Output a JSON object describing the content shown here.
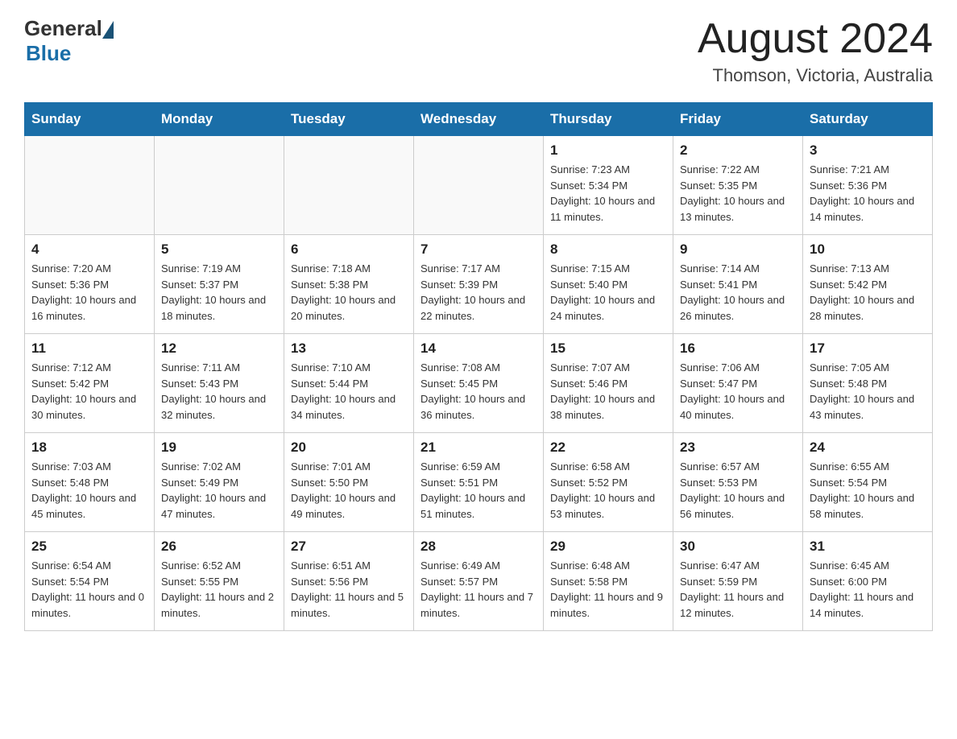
{
  "header": {
    "title": "August 2024",
    "location": "Thomson, Victoria, Australia",
    "logo_general": "General",
    "logo_blue": "Blue"
  },
  "calendar": {
    "days_of_week": [
      "Sunday",
      "Monday",
      "Tuesday",
      "Wednesday",
      "Thursday",
      "Friday",
      "Saturday"
    ],
    "weeks": [
      [
        {
          "day": "",
          "info": ""
        },
        {
          "day": "",
          "info": ""
        },
        {
          "day": "",
          "info": ""
        },
        {
          "day": "",
          "info": ""
        },
        {
          "day": "1",
          "info": "Sunrise: 7:23 AM\nSunset: 5:34 PM\nDaylight: 10 hours and 11 minutes."
        },
        {
          "day": "2",
          "info": "Sunrise: 7:22 AM\nSunset: 5:35 PM\nDaylight: 10 hours and 13 minutes."
        },
        {
          "day": "3",
          "info": "Sunrise: 7:21 AM\nSunset: 5:36 PM\nDaylight: 10 hours and 14 minutes."
        }
      ],
      [
        {
          "day": "4",
          "info": "Sunrise: 7:20 AM\nSunset: 5:36 PM\nDaylight: 10 hours and 16 minutes."
        },
        {
          "day": "5",
          "info": "Sunrise: 7:19 AM\nSunset: 5:37 PM\nDaylight: 10 hours and 18 minutes."
        },
        {
          "day": "6",
          "info": "Sunrise: 7:18 AM\nSunset: 5:38 PM\nDaylight: 10 hours and 20 minutes."
        },
        {
          "day": "7",
          "info": "Sunrise: 7:17 AM\nSunset: 5:39 PM\nDaylight: 10 hours and 22 minutes."
        },
        {
          "day": "8",
          "info": "Sunrise: 7:15 AM\nSunset: 5:40 PM\nDaylight: 10 hours and 24 minutes."
        },
        {
          "day": "9",
          "info": "Sunrise: 7:14 AM\nSunset: 5:41 PM\nDaylight: 10 hours and 26 minutes."
        },
        {
          "day": "10",
          "info": "Sunrise: 7:13 AM\nSunset: 5:42 PM\nDaylight: 10 hours and 28 minutes."
        }
      ],
      [
        {
          "day": "11",
          "info": "Sunrise: 7:12 AM\nSunset: 5:42 PM\nDaylight: 10 hours and 30 minutes."
        },
        {
          "day": "12",
          "info": "Sunrise: 7:11 AM\nSunset: 5:43 PM\nDaylight: 10 hours and 32 minutes."
        },
        {
          "day": "13",
          "info": "Sunrise: 7:10 AM\nSunset: 5:44 PM\nDaylight: 10 hours and 34 minutes."
        },
        {
          "day": "14",
          "info": "Sunrise: 7:08 AM\nSunset: 5:45 PM\nDaylight: 10 hours and 36 minutes."
        },
        {
          "day": "15",
          "info": "Sunrise: 7:07 AM\nSunset: 5:46 PM\nDaylight: 10 hours and 38 minutes."
        },
        {
          "day": "16",
          "info": "Sunrise: 7:06 AM\nSunset: 5:47 PM\nDaylight: 10 hours and 40 minutes."
        },
        {
          "day": "17",
          "info": "Sunrise: 7:05 AM\nSunset: 5:48 PM\nDaylight: 10 hours and 43 minutes."
        }
      ],
      [
        {
          "day": "18",
          "info": "Sunrise: 7:03 AM\nSunset: 5:48 PM\nDaylight: 10 hours and 45 minutes."
        },
        {
          "day": "19",
          "info": "Sunrise: 7:02 AM\nSunset: 5:49 PM\nDaylight: 10 hours and 47 minutes."
        },
        {
          "day": "20",
          "info": "Sunrise: 7:01 AM\nSunset: 5:50 PM\nDaylight: 10 hours and 49 minutes."
        },
        {
          "day": "21",
          "info": "Sunrise: 6:59 AM\nSunset: 5:51 PM\nDaylight: 10 hours and 51 minutes."
        },
        {
          "day": "22",
          "info": "Sunrise: 6:58 AM\nSunset: 5:52 PM\nDaylight: 10 hours and 53 minutes."
        },
        {
          "day": "23",
          "info": "Sunrise: 6:57 AM\nSunset: 5:53 PM\nDaylight: 10 hours and 56 minutes."
        },
        {
          "day": "24",
          "info": "Sunrise: 6:55 AM\nSunset: 5:54 PM\nDaylight: 10 hours and 58 minutes."
        }
      ],
      [
        {
          "day": "25",
          "info": "Sunrise: 6:54 AM\nSunset: 5:54 PM\nDaylight: 11 hours and 0 minutes."
        },
        {
          "day": "26",
          "info": "Sunrise: 6:52 AM\nSunset: 5:55 PM\nDaylight: 11 hours and 2 minutes."
        },
        {
          "day": "27",
          "info": "Sunrise: 6:51 AM\nSunset: 5:56 PM\nDaylight: 11 hours and 5 minutes."
        },
        {
          "day": "28",
          "info": "Sunrise: 6:49 AM\nSunset: 5:57 PM\nDaylight: 11 hours and 7 minutes."
        },
        {
          "day": "29",
          "info": "Sunrise: 6:48 AM\nSunset: 5:58 PM\nDaylight: 11 hours and 9 minutes."
        },
        {
          "day": "30",
          "info": "Sunrise: 6:47 AM\nSunset: 5:59 PM\nDaylight: 11 hours and 12 minutes."
        },
        {
          "day": "31",
          "info": "Sunrise: 6:45 AM\nSunset: 6:00 PM\nDaylight: 11 hours and 14 minutes."
        }
      ]
    ]
  }
}
